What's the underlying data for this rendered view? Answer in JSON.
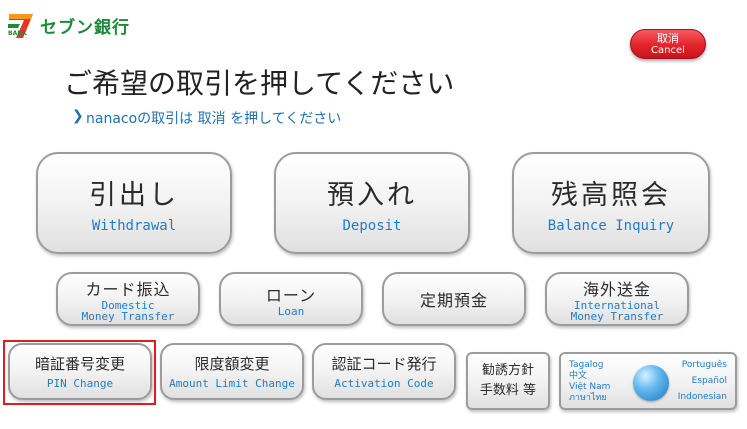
{
  "brand": {
    "name": "セブン銀行",
    "mark_text": "BANK",
    "color": "#1d8a3a"
  },
  "cancel": {
    "ja": "取消",
    "en": "Cancel"
  },
  "title": "ご希望の取引を押してください",
  "subtitle": "nanacoの取引は 取消 を押してください",
  "main_buttons": [
    {
      "ja": "引出し",
      "en": "Withdrawal"
    },
    {
      "ja": "預入れ",
      "en": "Deposit"
    },
    {
      "ja": "残高照会",
      "en": "Balance Inquiry"
    }
  ],
  "mid_buttons": [
    {
      "ja": "カード振込",
      "en1": "Domestic",
      "en2": "Money Transfer"
    },
    {
      "ja": "ローン",
      "en1": "Loan",
      "en2": ""
    },
    {
      "ja": "定期預金",
      "en1": "",
      "en2": ""
    },
    {
      "ja": "海外送金",
      "en1": "International",
      "en2": "Money Transfer"
    }
  ],
  "small_buttons": [
    {
      "ja": "暗証番号変更",
      "en": "PIN Change"
    },
    {
      "ja": "限度額変更",
      "en": "Amount Limit Change"
    },
    {
      "ja": "認証コード発行",
      "en": "Activation Code"
    }
  ],
  "fees_button": {
    "line1": "勧誘方針",
    "line2": "手数料 等"
  },
  "language_button": {
    "left": [
      "Tagalog",
      "中文",
      "Việt Nam",
      "ภาษาไทย"
    ],
    "right": [
      "Português",
      "Español",
      "Indonesian"
    ]
  },
  "accent_colors": {
    "english_text": "#1f7cc9",
    "cancel": "#e3242c",
    "highlight": "#e21b23"
  }
}
